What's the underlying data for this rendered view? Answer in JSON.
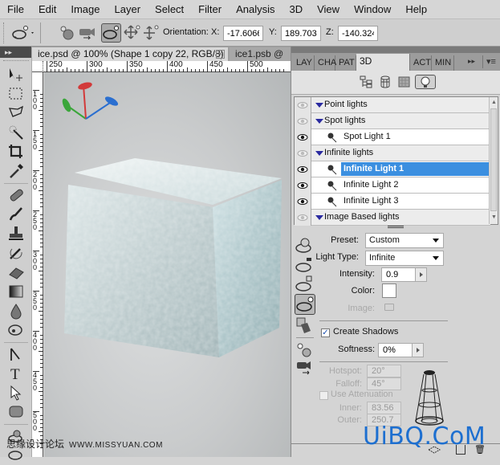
{
  "menubar": {
    "items": [
      "File",
      "Edit",
      "Image",
      "Layer",
      "Select",
      "Filter",
      "Analysis",
      "3D",
      "View",
      "Window",
      "Help"
    ]
  },
  "options_bar": {
    "tool_icon": "3d-light-rotate-icon",
    "orientation_label": "Orientation:",
    "x_label": "X:",
    "x_value": "-17.6066",
    "y_label": "Y:",
    "y_value": "189.7034",
    "z_label": "Z:",
    "z_value": "-140.324"
  },
  "document": {
    "tabs": [
      {
        "label": "ice.psd @ 100% (Shape 1 copy 22, RGB/8) *",
        "active": true
      },
      {
        "label": "ice1.psb @",
        "active": false
      }
    ],
    "ruler_h": [
      "250",
      "300",
      "350",
      "400",
      "450",
      "500"
    ],
    "ruler_v": [
      "100",
      "150",
      "200",
      "250",
      "300",
      "350",
      "400",
      "450",
      "500"
    ]
  },
  "panel": {
    "tabs": [
      {
        "label": "LAY",
        "active": false
      },
      {
        "label": "CHA",
        "active": false
      },
      {
        "label": "PAT",
        "active": false
      },
      {
        "label": "3D (LIGHTS)",
        "active": true
      },
      {
        "label": "ACT",
        "active": false
      },
      {
        "label": "MIN",
        "active": false
      }
    ],
    "filter_icons": [
      "scene-icon",
      "mesh-icon",
      "materials-icon",
      "lights-icon"
    ],
    "lights": [
      {
        "label": "Point lights",
        "type": "group",
        "visible": false
      },
      {
        "label": "Spot lights",
        "type": "group",
        "visible": false
      },
      {
        "label": "Spot Light 1",
        "type": "item",
        "visible": true,
        "selected": false
      },
      {
        "label": "Infinite lights",
        "type": "group",
        "visible": false
      },
      {
        "label": "Infinite Light 1",
        "type": "item",
        "visible": true,
        "selected": true
      },
      {
        "label": "Infinite Light 2",
        "type": "item",
        "visible": true,
        "selected": false
      },
      {
        "label": "Infinite Light 3",
        "type": "item",
        "visible": true,
        "selected": false
      },
      {
        "label": "Image Based lights",
        "type": "group",
        "visible": false
      }
    ],
    "properties": {
      "preset_label": "Preset:",
      "preset_value": "Custom",
      "light_type_label": "Light Type:",
      "light_type_value": "Infinite",
      "intensity_label": "Intensity:",
      "intensity_value": "0.9",
      "color_label": "Color:",
      "color_value": "#ffffff",
      "image_label": "Image:",
      "create_shadows_label": "Create Shadows",
      "create_shadows_checked": true,
      "softness_label": "Softness:",
      "softness_value": "0%",
      "hotspot_label": "Hotspot:",
      "hotspot_value": "20°",
      "falloff_label": "Falloff:",
      "falloff_value": "45°",
      "use_attenuation_label": "Use Attenuation",
      "use_attenuation_checked": false,
      "inner_label": "Inner:",
      "inner_value": "83.56",
      "outer_label": "Outer:",
      "outer_value": "250.7"
    }
  },
  "watermarks": {
    "forum_cn": "思缘设计论坛",
    "forum_url": "WWW.MISSYUAN.COM",
    "brand": "UiBQ.CoM"
  },
  "colors": {
    "selection": "#3b8fe0",
    "axis_x": "#d23a3a",
    "axis_y": "#3aa63a",
    "axis_z": "#2a6fd0",
    "brand_watermark": "#1d6fd0"
  }
}
